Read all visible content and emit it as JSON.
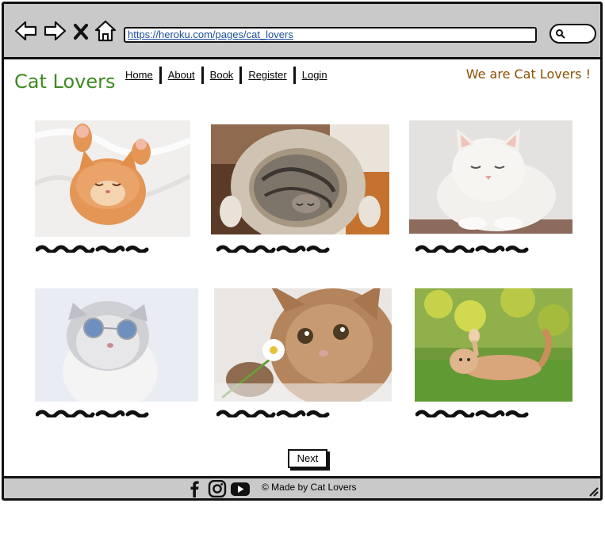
{
  "browser": {
    "url": "https://heroku.com/pages/cat_lovers",
    "icons": [
      "back-arrow-icon",
      "forward-arrow-icon",
      "close-icon",
      "home-icon",
      "search-icon"
    ]
  },
  "header": {
    "brand": "Cat Lovers",
    "slogan": "We are Cat Lovers !",
    "nav": [
      "Home",
      "About",
      "Book",
      "Register",
      "Login"
    ]
  },
  "gallery": {
    "photos": [
      {
        "subject": "orange kitten sleeping on fur blanket"
      },
      {
        "subject": "tabby cat curled in round cat bed"
      },
      {
        "subject": "white cat lying down"
      },
      {
        "subject": "grey persian cat with round sunglasses"
      },
      {
        "subject": "kitten holding a daisy"
      },
      {
        "subject": "kitten rolling on grass"
      }
    ]
  },
  "pagination": {
    "next_label": "Next"
  },
  "footer": {
    "copyright": "© Made by Cat Lovers",
    "social_icons": [
      "facebook-icon",
      "instagram-icon",
      "youtube-icon"
    ]
  },
  "colors": {
    "brand_green": "#3e8a22",
    "slogan_brown": "#8a4f00",
    "chrome_grey": "#c9c9c9"
  }
}
